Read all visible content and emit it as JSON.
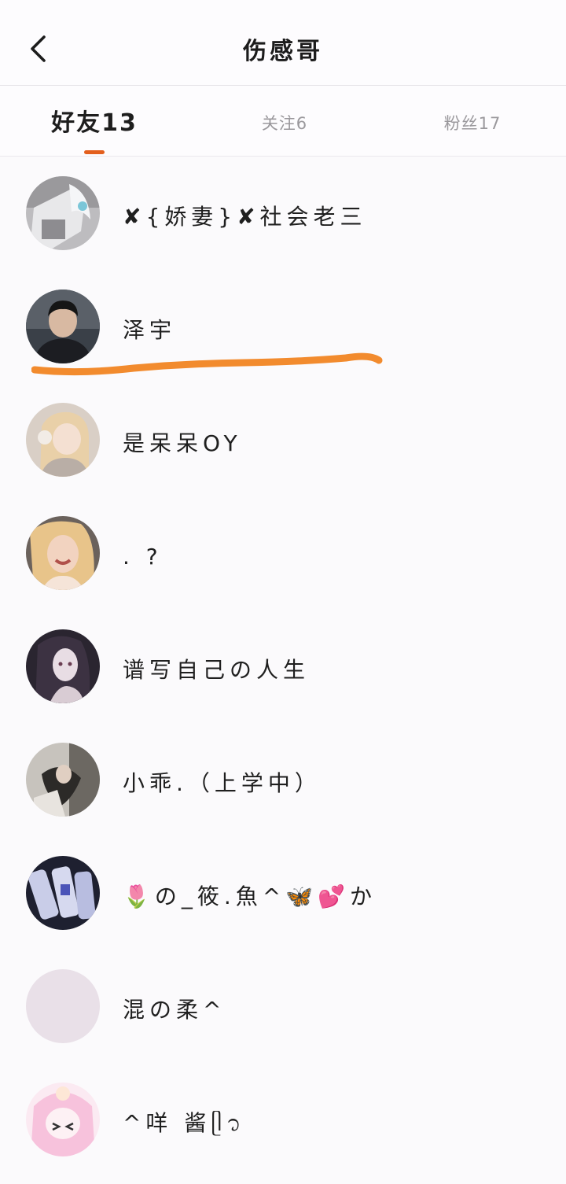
{
  "header": {
    "title": "伤感哥",
    "back_icon": "chevron-left-icon"
  },
  "tabs": [
    {
      "label": "好友13",
      "active": true
    },
    {
      "label": "关注6",
      "active": false
    },
    {
      "label": "粉丝17",
      "active": false
    }
  ],
  "accent_color": "#e35f1d",
  "friends": [
    {
      "name": "✘{娇妻}✘社会老三"
    },
    {
      "name": "泽宇"
    },
    {
      "name": "是呆呆OY"
    },
    {
      "name": ". ?"
    },
    {
      "name": "谱写自己の人生"
    },
    {
      "name": "小乖.（上学中）"
    },
    {
      "name": "🌷の_筱.魚^🦋💕か"
    },
    {
      "name": "混の柔^"
    },
    {
      "name": "^咩  酱ᥫ᭡"
    }
  ]
}
